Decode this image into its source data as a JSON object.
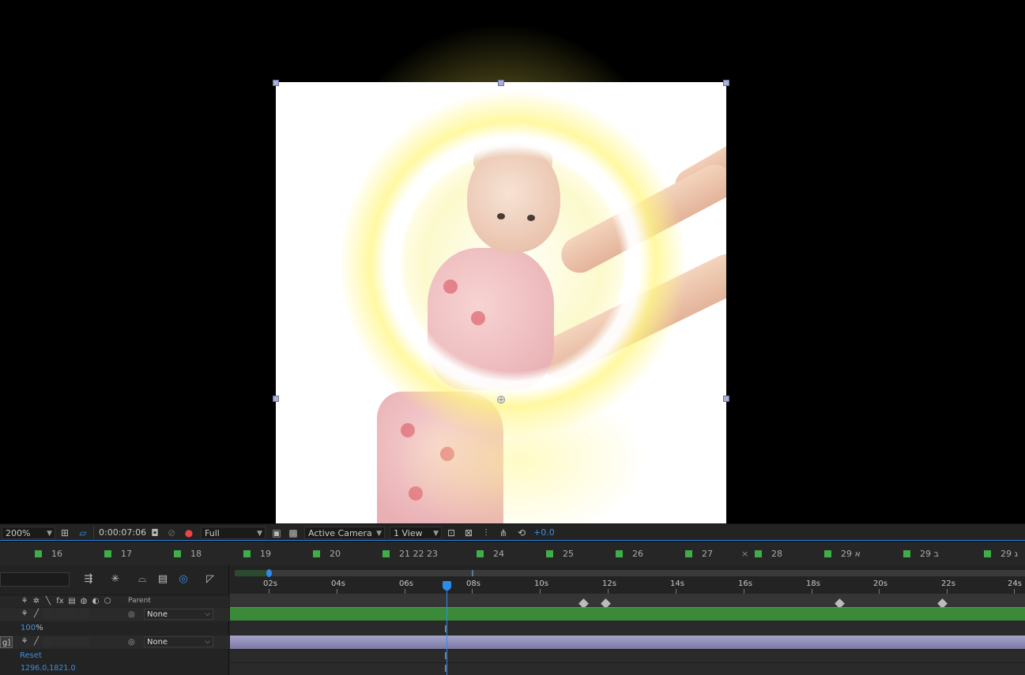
{
  "viewer": {
    "zoom": "200%",
    "timecode": "0:00:07:06",
    "resolution": "Full",
    "camera": "Active Camera",
    "views": "1 View",
    "exposure": "+0.0"
  },
  "markers": [
    {
      "label": "16"
    },
    {
      "label": "17"
    },
    {
      "label": "18"
    },
    {
      "label": "19"
    },
    {
      "label": "20"
    },
    {
      "label": "21 22 23"
    },
    {
      "label": "24"
    },
    {
      "label": "25"
    },
    {
      "label": "26"
    },
    {
      "label": "27"
    },
    {
      "label": "28"
    },
    {
      "label": "29 א"
    },
    {
      "label": "29 ב"
    },
    {
      "label": "29 ג"
    }
  ],
  "marker_separator": "×",
  "timeline": {
    "ruler_ticks": [
      "02s",
      "04s",
      "06s",
      "08s",
      "10s",
      "12s",
      "14s",
      "16s",
      "18s",
      "20s",
      "22s",
      "24s"
    ],
    "parent_header": "Parent",
    "layers": [
      {
        "parent": "None",
        "color": "#3a8a3a"
      },
      {
        "parent": "None",
        "color": "#8d8bb4",
        "name_fragment": "g]"
      }
    ],
    "property_value_percent": "100",
    "percent_sign": "%",
    "reset_label": "Reset",
    "position_value": "1296.0,1821.0"
  },
  "colors": {
    "accent": "#2d8ceb",
    "marker_green": "#3fae49",
    "layer_green": "#3a8a3a",
    "layer_purple": "#8d8bb4"
  }
}
